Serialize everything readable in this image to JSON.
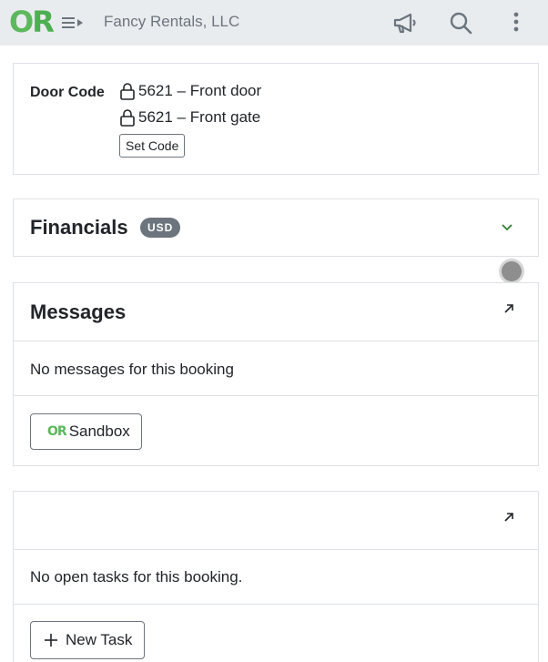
{
  "header": {
    "logo": {
      "o": "O",
      "r": "R"
    },
    "company_name": "Fancy Rentals, LLC",
    "icons": [
      "menu-icon",
      "megaphone-icon",
      "search-icon",
      "more-vertical-icon"
    ]
  },
  "door_code": {
    "label": "Door Code",
    "codes": [
      {
        "text": "5621 – Front door",
        "icon": "lock-icon"
      },
      {
        "text": "5621 – Front gate",
        "icon": "lock-icon"
      }
    ],
    "set_code_label": "Set Code"
  },
  "financials": {
    "title": "Financials",
    "currency_badge": "USD",
    "icon": "chevron-down-icon"
  },
  "messages": {
    "title": "Messages",
    "empty_text": "No messages for this booking",
    "sandbox_logo": {
      "o": "O",
      "r": "R"
    },
    "sandbox_label": "Sandbox",
    "icon": "expand-icon"
  },
  "tasks": {
    "title": "",
    "empty_text": "No open tasks for this booking.",
    "new_task_label": "New Task",
    "icon": "expand-icon"
  },
  "colors": {
    "brand_green": "#5cb85c",
    "header_bg": "#e9ecef",
    "badge_bg": "#6c757d",
    "chevron_green": "#2e7d32"
  }
}
